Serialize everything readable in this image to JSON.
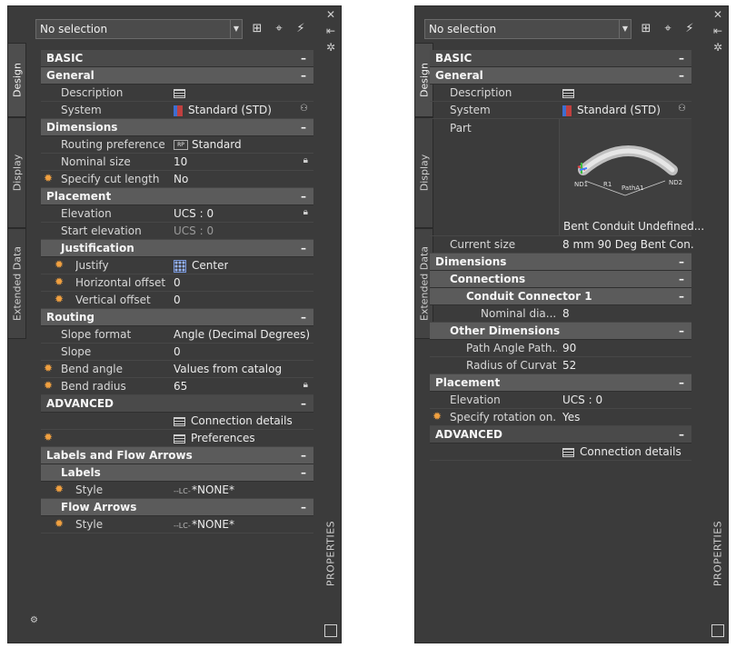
{
  "left": {
    "selection": "No selection",
    "tabs": [
      "Design",
      "Display",
      "Extended Data"
    ],
    "side_label": "PROPERTIES",
    "sections": {
      "basic": "BASIC",
      "general": "General",
      "description": "Description",
      "system_label": "System",
      "system_value": "Standard (STD)",
      "dimensions": "Dimensions",
      "routing_pref_label": "Routing preference",
      "routing_pref_value": "Standard",
      "nominal_label": "Nominal size",
      "nominal_value": "10",
      "cut_label": "Specify cut length",
      "cut_value": "No",
      "placement": "Placement",
      "elevation_label": "Elevation",
      "elevation_value": "UCS : 0",
      "start_elev_label": "Start elevation",
      "start_elev_value": "UCS : 0",
      "justification": "Justification",
      "justify_label": "Justify",
      "justify_value": "Center",
      "hoff_label": "Horizontal offset",
      "hoff_value": "0",
      "voff_label": "Vertical offset",
      "voff_value": "0",
      "routing": "Routing",
      "slope_format_label": "Slope format",
      "slope_format_value": "Angle (Decimal Degrees)",
      "slope_label": "Slope",
      "slope_value": "0",
      "bend_angle_label": "Bend angle",
      "bend_angle_value": "Values from catalog",
      "bend_radius_label": "Bend radius",
      "bend_radius_value": "65",
      "advanced": "ADVANCED",
      "connection_details": "Connection details",
      "preferences": "Preferences",
      "labels_flow": "Labels and Flow Arrows",
      "labels": "Labels",
      "style_label": "Style",
      "style_value": "*NONE*",
      "flow_arrows": "Flow Arrows",
      "style2_label": "Style",
      "style2_value": "*NONE*",
      "style_icon_text": "--LC-"
    }
  },
  "right": {
    "selection": "No selection",
    "tabs": [
      "Design",
      "Display",
      "Extended Data"
    ],
    "side_label": "PROPERTIES",
    "sections": {
      "basic": "BASIC",
      "general": "General",
      "description": "Description",
      "system_label": "System",
      "system_value": "Standard (STD)",
      "part_label": "Part",
      "part_caption": "Bent Conduit Undefined...",
      "preview_labels": {
        "nd1": "ND1",
        "r1": "R1",
        "path": "PathA1",
        "nd2": "ND2"
      },
      "current_size_label": "Current size",
      "current_size_value": "8 mm 90 Deg Bent Con...",
      "dimensions": "Dimensions",
      "connections": "Connections",
      "conduit_connector": "Conduit Connector 1",
      "nominal_dia_label": "Nominal dia...",
      "nominal_dia_value": "8",
      "other_dimensions": "Other Dimensions",
      "path_angle_label": "Path Angle Path...",
      "path_angle_value": "90",
      "radius_label": "Radius of Curvat...",
      "radius_value": "52",
      "placement": "Placement",
      "elevation_label": "Elevation",
      "elevation_value": "UCS : 0",
      "rotation_label": "Specify rotation on...",
      "rotation_value": "Yes",
      "advanced": "ADVANCED",
      "connection_details": "Connection details"
    }
  },
  "colors": {
    "panel": "#3b3b3b",
    "header": "#5b5b5b",
    "asterisk": "#f0a040"
  },
  "icons": [
    "add-object-icon",
    "crosshair-icon",
    "quick-select-icon",
    "close-icon",
    "auto-hide-icon",
    "settings-icon",
    "table-icon",
    "lock-icon",
    "binoculars-icon"
  ]
}
